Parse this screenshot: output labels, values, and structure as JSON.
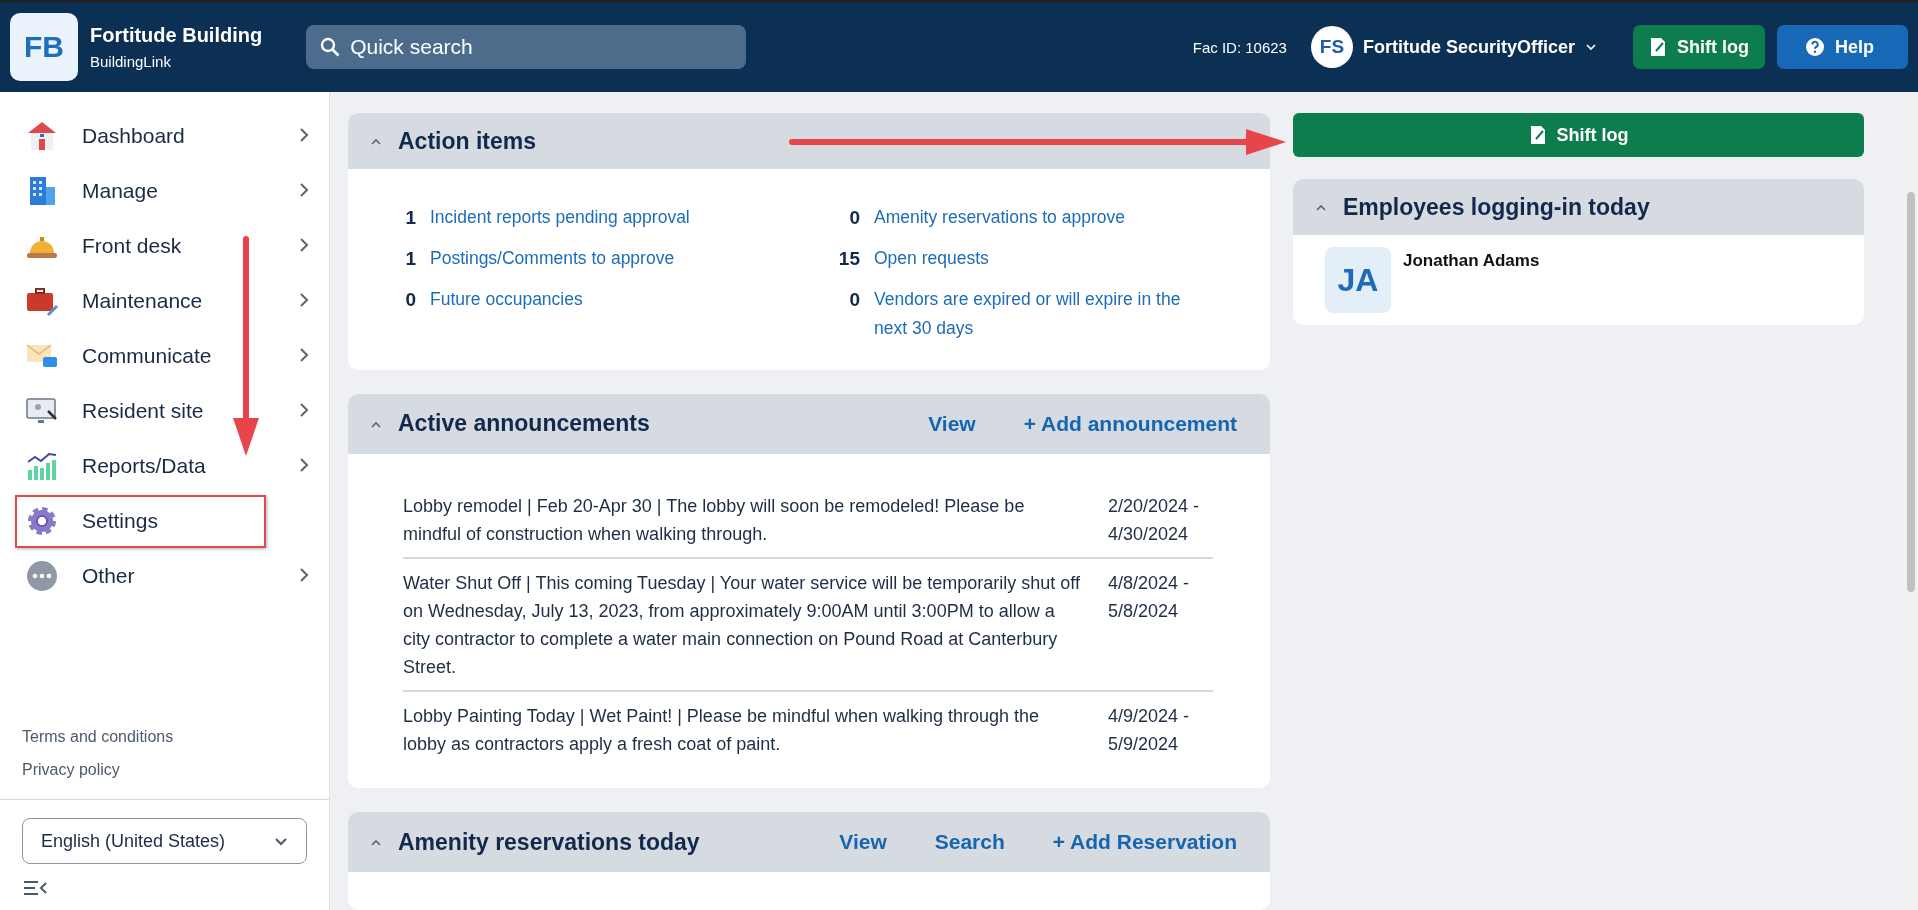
{
  "header": {
    "logo": "FB",
    "building_name": "Fortitude Building",
    "brand": "BuildingLink",
    "search": {
      "placeholder": "Quick search"
    },
    "facility_id": "Fac ID: 10623",
    "user": {
      "initials": "FS",
      "name": "Fortitude SecurityOfficer"
    },
    "buttons": [
      {
        "label": "Shift log",
        "kind": "shift"
      },
      {
        "label": "Help",
        "kind": "help"
      }
    ]
  },
  "sidebar": {
    "items": [
      {
        "label": "Dashboard",
        "has_submenu": true,
        "highlighted": false
      },
      {
        "label": "Manage",
        "has_submenu": true,
        "highlighted": false
      },
      {
        "label": "Front desk",
        "has_submenu": true,
        "highlighted": false
      },
      {
        "label": "Maintenance",
        "has_submenu": true,
        "highlighted": false
      },
      {
        "label": "Communicate",
        "has_submenu": true,
        "highlighted": false
      },
      {
        "label": "Resident site",
        "has_submenu": true,
        "highlighted": false
      },
      {
        "label": "Reports/Data",
        "has_submenu": true,
        "highlighted": false
      },
      {
        "label": "Settings",
        "has_submenu": false,
        "highlighted": true
      },
      {
        "label": "Other",
        "has_submenu": true,
        "highlighted": false
      }
    ],
    "links": [
      "Terms and conditions",
      "Privacy policy"
    ],
    "language": "English (United States)"
  },
  "action_items": {
    "title": "Action items",
    "expanded": true,
    "items": [
      {
        "count": "1",
        "label": "Incident reports pending approval"
      },
      {
        "count": "1",
        "label": "Postings/Comments to approve"
      },
      {
        "count": "0",
        "label": "Future occupancies"
      },
      {
        "count": "0",
        "label": "Amenity reservations to approve"
      },
      {
        "count": "15",
        "label": "Open requests"
      },
      {
        "count": "0",
        "label": "Vendors are expired or will expire in the next 30 days"
      }
    ]
  },
  "announcements": {
    "title": "Active announcements",
    "expanded": true,
    "actions": [
      "View",
      "+ Add announcement"
    ],
    "rows": [
      {
        "text": "Lobby remodel | Feb 20-Apr 30 | The lobby will soon be remodeled! Please be mindful of construction when walking through.",
        "dates": "2/20/2024 - 4/30/2024"
      },
      {
        "text": "Water Shut Off | This coming Tuesday | Your water service will be temporarily shut off on Wednesday, July 13, 2023, from approximately 9:00AM until 3:00PM to allow a city contractor to complete a water main connection on Pound Road at Canterbury Street.",
        "dates": "4/8/2024 - 5/8/2024"
      },
      {
        "text": "Lobby Painting Today | Wet Paint! | Please be mindful when walking through the lobby as contractors apply a fresh coat of paint.",
        "dates": "4/9/2024 - 5/9/2024"
      }
    ]
  },
  "amenity_reservations": {
    "title": "Amenity reservations today",
    "expanded": true,
    "actions": [
      "View",
      "Search",
      "+ Add Reservation"
    ]
  },
  "right_panel": {
    "shift_log_button": "Shift log",
    "employees": {
      "title": "Employees logging-in today",
      "expanded": true,
      "people": [
        {
          "initials": "JA",
          "name": "Jonathan Adams"
        }
      ]
    }
  },
  "annotations": [
    {
      "kind": "arrow-down"
    },
    {
      "kind": "arrow-right"
    }
  ]
}
